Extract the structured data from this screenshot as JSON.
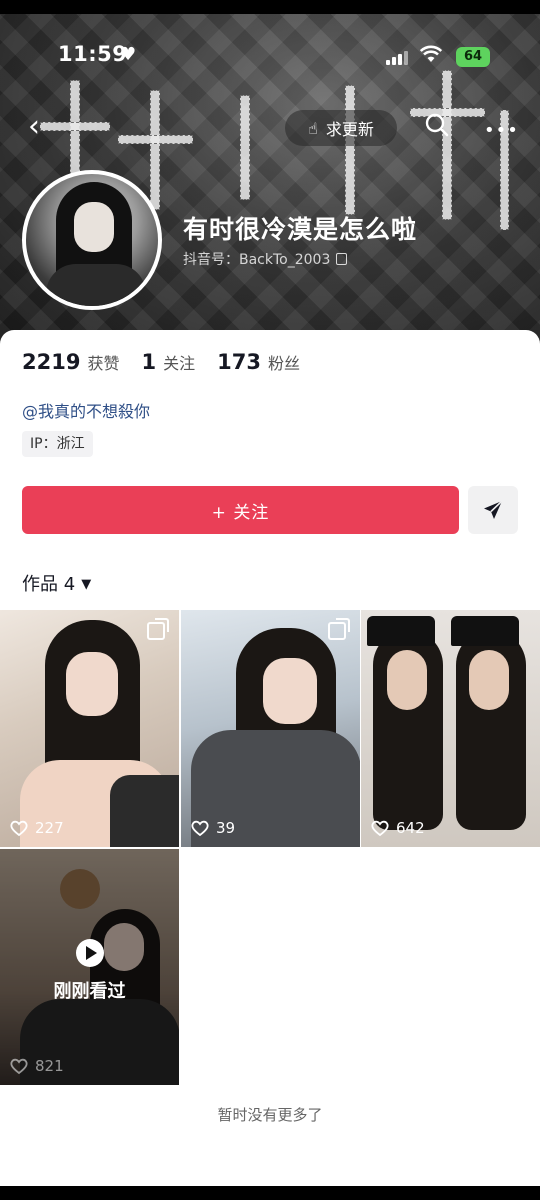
{
  "status_bar": {
    "time": "11:59",
    "battery": "64"
  },
  "nav": {
    "request_update_label": "求更新"
  },
  "profile": {
    "nickname": "有时很冷漠是怎么啦",
    "douyin_id": "抖音号：BackTo_2003",
    "likes_count": "2219",
    "likes_label": "获赞",
    "following_count": "1",
    "following_label": "关注",
    "followers_count": "173",
    "followers_label": "粉丝",
    "mention": "@我真的不想殺你",
    "ip_location": "IP：浙江"
  },
  "actions": {
    "follow_label": "+ 关注"
  },
  "works": {
    "tab_label": "作品 4",
    "items": [
      {
        "likes": "227",
        "type": "image-set"
      },
      {
        "likes": "39",
        "type": "image-set"
      },
      {
        "likes": "642",
        "type": "video"
      },
      {
        "likes": "821",
        "type": "video",
        "watched_label": "刚刚看过"
      }
    ]
  },
  "footer": {
    "end_text": "暂时没有更多了"
  },
  "colors": {
    "follow_button": "#ea3f57",
    "mention_link": "#2f4f87",
    "battery": "#5ed35e"
  }
}
